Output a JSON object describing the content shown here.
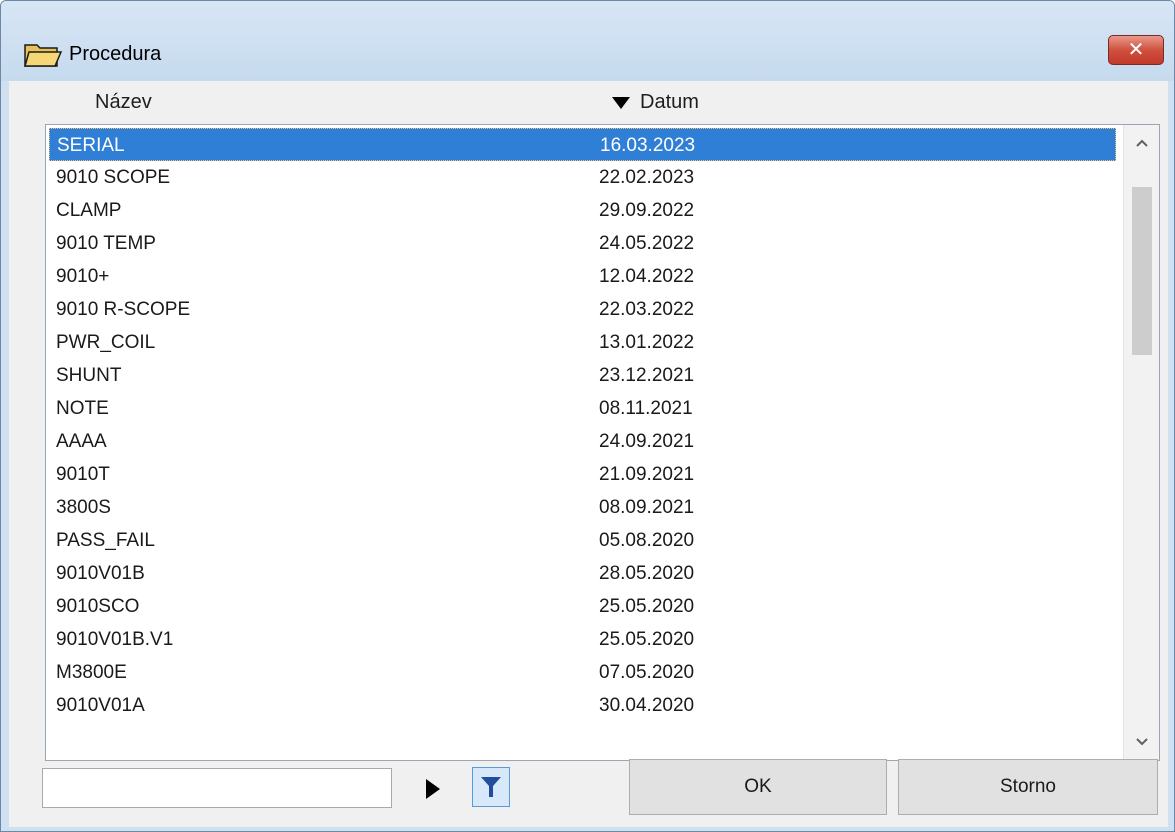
{
  "window": {
    "title": "Procedura",
    "close_label": "✕"
  },
  "columns": {
    "name": "Název",
    "date": "Datum",
    "sort": "descending"
  },
  "rows": [
    {
      "name": "SERIAL",
      "date": "16.03.2023",
      "selected": true
    },
    {
      "name": "9010 SCOPE",
      "date": "22.02.2023"
    },
    {
      "name": "CLAMP",
      "date": "29.09.2022"
    },
    {
      "name": "9010 TEMP",
      "date": "24.05.2022"
    },
    {
      "name": "9010+",
      "date": "12.04.2022"
    },
    {
      "name": "9010 R-SCOPE",
      "date": "22.03.2022"
    },
    {
      "name": "PWR_COIL",
      "date": "13.01.2022"
    },
    {
      "name": "SHUNT",
      "date": "23.12.2021"
    },
    {
      "name": "NOTE",
      "date": "08.11.2021"
    },
    {
      "name": "AAAA",
      "date": "24.09.2021"
    },
    {
      "name": "9010T",
      "date": "21.09.2021"
    },
    {
      "name": "3800S",
      "date": "08.09.2021"
    },
    {
      "name": "PASS_FAIL",
      "date": "05.08.2020"
    },
    {
      "name": "9010V01B",
      "date": "28.05.2020"
    },
    {
      "name": "9010SCO",
      "date": "25.05.2020"
    },
    {
      "name": "9010V01B.V1",
      "date": "25.05.2020"
    },
    {
      "name": "M3800E",
      "date": "07.05.2020"
    },
    {
      "name": "9010V01A",
      "date": "30.04.2020"
    }
  ],
  "filter": {
    "value": "",
    "placeholder": ""
  },
  "buttons": {
    "ok": "OK",
    "cancel": "Storno"
  },
  "icons": {
    "title": "open-folder-icon",
    "close": "close-icon",
    "sort": "sort-descending-icon",
    "go": "play-icon",
    "filter": "filter-icon"
  },
  "colors": {
    "selection": "#2f7fd6",
    "close_button": "#c2392a",
    "filter_icon": "#1f4e9c"
  }
}
